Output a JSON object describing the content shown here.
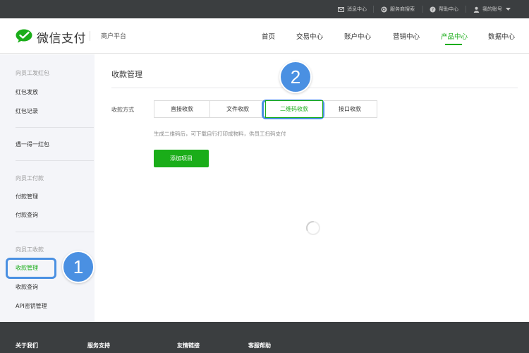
{
  "topbar": {
    "messages": "消息中心",
    "provider_search": "服务商搜索",
    "help": "帮助中心",
    "account": "我的账号"
  },
  "header": {
    "logo_text": "微信支付",
    "merchant_platform": "商户平台",
    "nav": [
      "首页",
      "交易中心",
      "账户中心",
      "营销中心",
      "产品中心",
      "数据中心"
    ],
    "active_nav": "产品中心"
  },
  "sidebar": {
    "group1": "向员工发红包",
    "item_hb_send": "红包发放",
    "item_hb_record": "红包记录",
    "item_yideyi": "遇一得一红包",
    "group2": "向员工付款",
    "item_pay_manage": "付款管理",
    "item_pay_query": "付款查询",
    "group3": "向员工收款",
    "item_collect_manage": "收款管理",
    "item_collect_query": "收款查询",
    "item_api_key": "API密钥管理"
  },
  "main": {
    "title": "收款管理",
    "method_label": "收款方式",
    "tabs": [
      "直接收款",
      "文件收款",
      "二维码收款",
      "接口收款"
    ],
    "selected_tab": "二维码收款",
    "hint": "生成二维码后，可下载自行打印成物料，供员工扫码支付",
    "add_button": "添加项目"
  },
  "annotations": {
    "badge1": "1",
    "badge2": "2"
  },
  "footer": {
    "about": "关于我们",
    "support": "服务支持",
    "links": "友情链接",
    "customer_help": "客服帮助"
  },
  "colors": {
    "brand_green": "#1aad19",
    "topbar_bg": "#3b3e40",
    "sidebar_bg": "#f4f5f9",
    "annotation_blue": "#4a90e2"
  }
}
